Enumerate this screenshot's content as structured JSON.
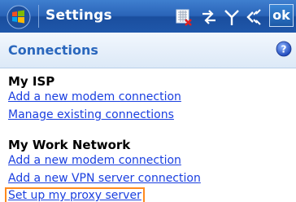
{
  "titlebar": {
    "app_title": "Settings",
    "ok_label": "ok",
    "icons": [
      "start-windows-icon",
      "sim-card-icon",
      "connectivity-arrows-icon",
      "signal-antenna-icon",
      "speaker-icon"
    ]
  },
  "header": {
    "section_title": "Connections",
    "help_icon": "help-question-icon"
  },
  "groups": [
    {
      "title": "My ISP",
      "links": [
        "Add a new modem connection",
        "Manage existing connections"
      ]
    },
    {
      "title": "My Work Network",
      "links": [
        "Add a new modem connection",
        "Add a new VPN server connection",
        "Set up my proxy server"
      ]
    }
  ],
  "selected_link": "Set up my proxy server",
  "colors": {
    "title_bar": "#2a64b8",
    "section_title": "#2a67bd",
    "link": "#1a3fe0",
    "selection_outline": "#ff8a1e"
  }
}
